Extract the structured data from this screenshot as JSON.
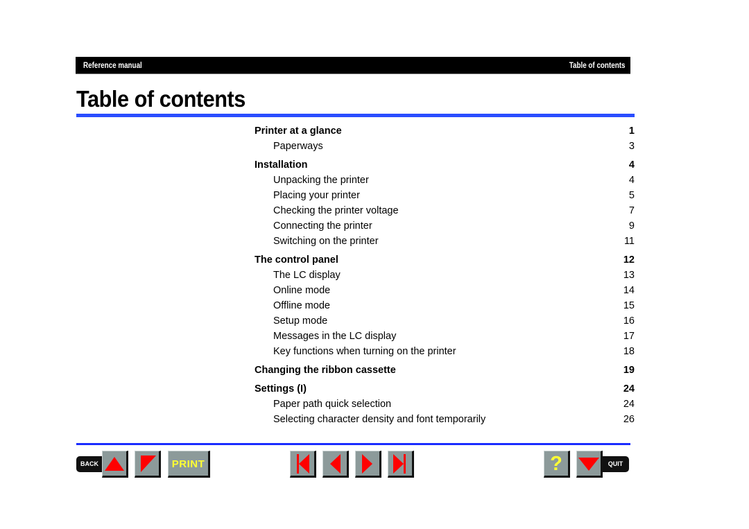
{
  "header": {
    "left_label": "Reference manual",
    "right_label": "Table of contents"
  },
  "page_title": "Table of contents",
  "toc": [
    {
      "level": "heading",
      "label": "Printer at a glance",
      "page": "1"
    },
    {
      "level": "sub",
      "label": "Paperways",
      "page": "3"
    },
    {
      "level": "heading",
      "label": "Installation",
      "page": "4"
    },
    {
      "level": "sub",
      "label": "Unpacking the printer",
      "page": "4"
    },
    {
      "level": "sub",
      "label": "Placing your printer",
      "page": "5"
    },
    {
      "level": "sub",
      "label": "Checking the printer voltage",
      "page": "7"
    },
    {
      "level": "sub",
      "label": "Connecting the printer",
      "page": "9"
    },
    {
      "level": "sub",
      "label": "Switching on the printer",
      "page": "11"
    },
    {
      "level": "heading",
      "label": "The control panel",
      "page": "12"
    },
    {
      "level": "sub",
      "label": "The LC display",
      "page": "13"
    },
    {
      "level": "sub",
      "label": "Online mode",
      "page": "14"
    },
    {
      "level": "sub",
      "label": "Offline mode",
      "page": "15"
    },
    {
      "level": "sub",
      "label": "Setup mode",
      "page": "16"
    },
    {
      "level": "sub",
      "label": "Messages in the LC display",
      "page": "17"
    },
    {
      "level": "sub",
      "label": "Key functions when turning on the printer",
      "page": "18"
    },
    {
      "level": "heading",
      "label": "Changing the ribbon cassette",
      "page": "19"
    },
    {
      "level": "heading",
      "label": "Settings (I)",
      "page": "24"
    },
    {
      "level": "sub",
      "label": "Paper path quick selection",
      "page": "24"
    },
    {
      "level": "sub",
      "label": "Selecting character density and font temporarily",
      "page": "26"
    }
  ],
  "footer": {
    "back_label": "BACK",
    "print_label": "PRINT",
    "help_label": "?",
    "quit_label": "QUIT",
    "icons": [
      "up-arrow-icon",
      "bookmark-triangle-icon",
      "first-page-icon",
      "previous-page-icon",
      "next-page-icon",
      "last-page-icon",
      "help-icon",
      "down-arrow-icon"
    ]
  },
  "colors": {
    "accent_rule": "#2a4dff",
    "button_gray": "#8c9a9a",
    "icon_red": "#ff0000",
    "label_yellow": "#ffff33"
  }
}
